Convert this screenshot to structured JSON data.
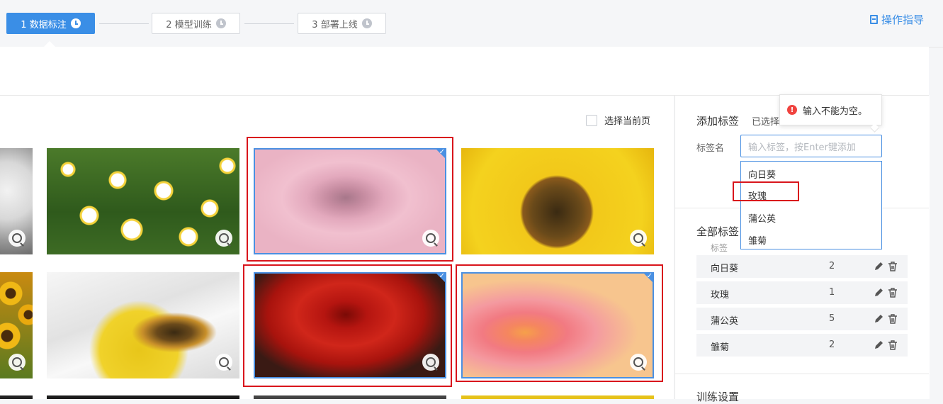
{
  "steps": [
    {
      "label": "1 数据标注"
    },
    {
      "label": "2 模型训练"
    },
    {
      "label": "3 部署上线"
    }
  ],
  "guide_label": "操作指导",
  "select_page_label": "选择当前页",
  "images": [
    {
      "subject": "white flower (partial)",
      "selected": false
    },
    {
      "subject": "daisies field",
      "selected": false
    },
    {
      "subject": "pink rose",
      "selected": true
    },
    {
      "subject": "sunflower",
      "selected": false
    },
    {
      "subject": "sunflowers (partial)",
      "selected": false
    },
    {
      "subject": "daisy with beetle",
      "selected": false
    },
    {
      "subject": "red rose",
      "selected": true
    },
    {
      "subject": "pink camellia",
      "selected": true
    }
  ],
  "panel": {
    "add_label_title": "添加标签",
    "selected_prefix": "已选择",
    "tag_name_label": "标签名",
    "input_placeholder": "输入标签，按Enter键添加",
    "dropdown_options": [
      "向日葵",
      "玫瑰",
      "蒲公英",
      "雏菊"
    ],
    "error_message": "输入不能为空。",
    "all_labels_title": "全部标签",
    "table_headers": {
      "label": "标签"
    },
    "rows": [
      {
        "name": "向日葵",
        "count": "2"
      },
      {
        "name": "玫瑰",
        "count": "1"
      },
      {
        "name": "蒲公英",
        "count": "5"
      },
      {
        "name": "雏菊",
        "count": "2"
      }
    ],
    "training_title": "训练设置"
  },
  "colors": {
    "accent": "#3a8ee6",
    "selection": "#4a90e2",
    "highlight_red": "#d9151c",
    "error": "#f0433f"
  },
  "icons": [
    "clock-icon",
    "doc-icon",
    "zoom-icon",
    "check-icon",
    "error-icon",
    "pencil-icon",
    "trash-icon"
  ]
}
